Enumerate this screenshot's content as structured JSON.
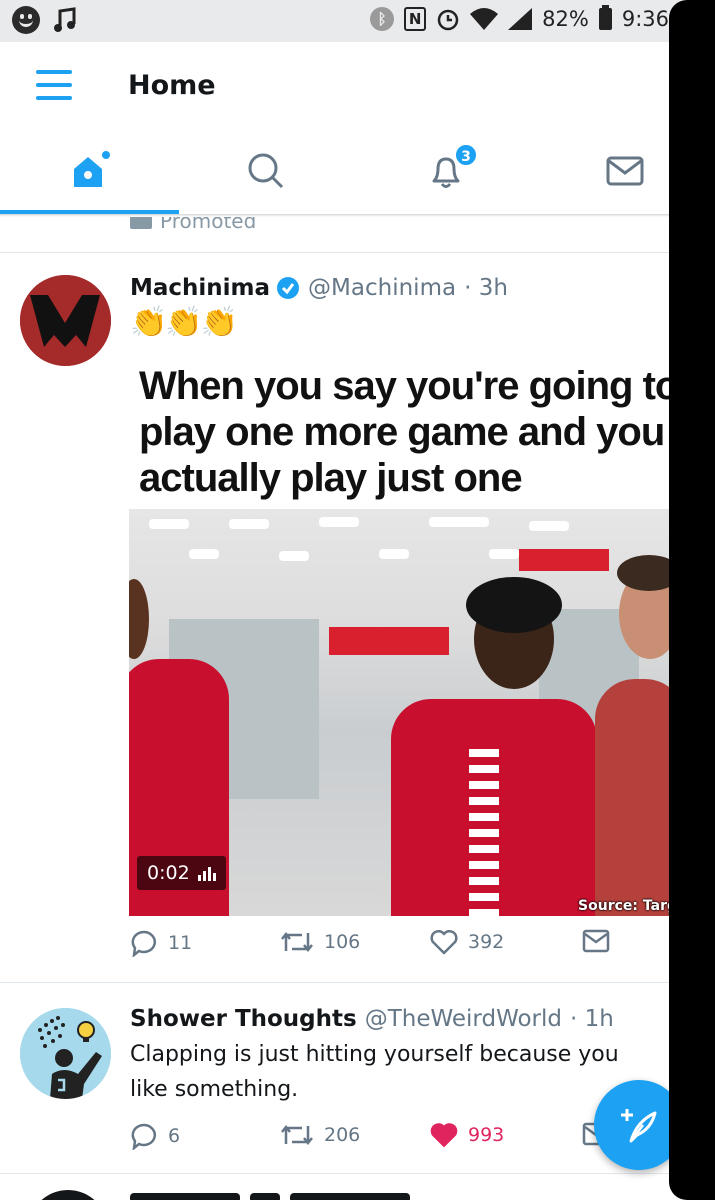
{
  "status_bar": {
    "battery": "82%",
    "time": "9:36",
    "icons": [
      "smiley-icon",
      "music-note-icon",
      "bluetooth-icon",
      "nfc-icon",
      "alarm-icon",
      "wifi-icon",
      "signal-icon",
      "battery-icon"
    ]
  },
  "header": {
    "title": "Home"
  },
  "tabs": [
    {
      "name": "home",
      "icon": "home-icon",
      "active": true
    },
    {
      "name": "search",
      "icon": "search-icon",
      "active": false
    },
    {
      "name": "notifications",
      "icon": "bell-icon",
      "badge": "3",
      "active": false
    },
    {
      "name": "messages",
      "icon": "envelope-icon",
      "active": false
    }
  ],
  "promoted": {
    "label": "Promoted"
  },
  "tweets": [
    {
      "display_name": "Machinima",
      "verified": true,
      "handle": "@Machinima",
      "time": "· 3h",
      "text": "👏👏👏",
      "media": {
        "caption": "When you say you're going to play one more game and you actually play just one",
        "video_time": "0:02",
        "source": "Source: Targ"
      },
      "reply_count": "11",
      "retweet_count": "106",
      "like_count": "392",
      "liked": false
    },
    {
      "display_name": "Shower Thoughts",
      "verified": false,
      "handle": "@TheWeirdWorld",
      "time": "· 1h",
      "text": "Clapping is just hitting yourself because you like something.",
      "reply_count": "6",
      "retweet_count": "206",
      "like_count": "993",
      "liked": true
    }
  ],
  "colors": {
    "accent": "#1da1f2",
    "like": "#e0245e",
    "muted": "#657786"
  }
}
